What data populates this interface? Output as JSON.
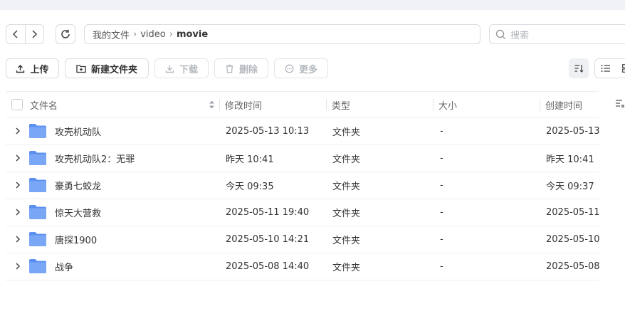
{
  "nav": {
    "back_icon": "chevron-left-icon",
    "forward_icon": "chevron-right-icon",
    "refresh_icon": "refresh-icon"
  },
  "breadcrumb": {
    "items": [
      "我的文件",
      "video"
    ],
    "current": "movie"
  },
  "search": {
    "placeholder": "搜索",
    "value": ""
  },
  "toolbar": {
    "upload": "上传",
    "new_folder": "新建文件夹",
    "download": "下载",
    "delete": "删除",
    "more": "更多"
  },
  "table": {
    "columns": {
      "name": "文件名",
      "modified": "修改时间",
      "type": "类型",
      "size": "大小",
      "created": "创建时间"
    },
    "rows": [
      {
        "name": "攻壳机动队",
        "modified": "2025-05-13 10:13",
        "type": "文件夹",
        "size": "-",
        "created": "2025-05-13"
      },
      {
        "name": "攻壳机动队2：无罪",
        "modified": "昨天 10:41",
        "type": "文件夹",
        "size": "-",
        "created": "昨天 10:41"
      },
      {
        "name": "豪勇七蛟龙",
        "modified": "今天 09:35",
        "type": "文件夹",
        "size": "-",
        "created": "今天 09:37"
      },
      {
        "name": "惊天大营救",
        "modified": "2025-05-11 19:40",
        "type": "文件夹",
        "size": "-",
        "created": "2025-05-11"
      },
      {
        "name": "唐探1900",
        "modified": "2025-05-10 14:21",
        "type": "文件夹",
        "size": "-",
        "created": "2025-05-10"
      },
      {
        "name": "战争",
        "modified": "2025-05-08 14:40",
        "type": "文件夹",
        "size": "-",
        "created": "2025-05-08"
      }
    ]
  },
  "colors": {
    "folder": "#7aa7f5",
    "folder_dark": "#5b8ff0",
    "border": "#d9dce1"
  }
}
